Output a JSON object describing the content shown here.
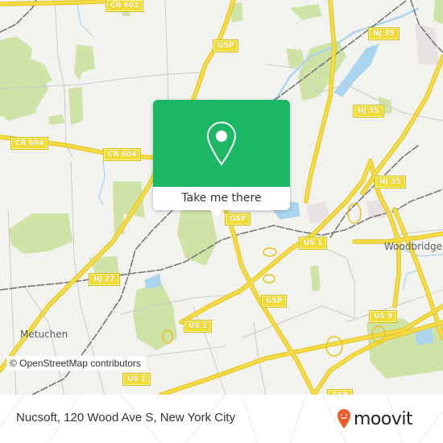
{
  "map": {
    "colors": {
      "background": "#f2f2ee",
      "park": "#cfe3a6",
      "water": "#a9d6ee",
      "highway": "#f5dc47",
      "highway_casing": "#e3c51c",
      "minor_road": "#c9c9c9",
      "railway": "#777777"
    },
    "road_shields": [
      {
        "id": "cr602",
        "label": "CR 602"
      },
      {
        "id": "gsp-north",
        "label": "GSP"
      },
      {
        "id": "nj35-north",
        "label": "NJ 35"
      },
      {
        "id": "nj35-mid",
        "label": "NJ 35"
      },
      {
        "id": "cr604-west",
        "label": "CR 604"
      },
      {
        "id": "cr604-east",
        "label": "CR 604"
      },
      {
        "id": "nj35-south",
        "label": "NJ 35"
      },
      {
        "id": "gsp-center",
        "label": "GSP"
      },
      {
        "id": "us1-east",
        "label": "US 1"
      },
      {
        "id": "nj27",
        "label": "NJ 27"
      },
      {
        "id": "gsp-south",
        "label": "GSP"
      },
      {
        "id": "us1-west",
        "label": "US 1"
      },
      {
        "id": "us9",
        "label": "US 9"
      },
      {
        "id": "us1-bottom",
        "label": "US 1"
      },
      {
        "id": "gsp-bottom",
        "label": "GSP"
      }
    ],
    "places": [
      {
        "id": "metuchen",
        "label": "Metuchen"
      },
      {
        "id": "woodbridge",
        "label": "Woodbridge"
      }
    ],
    "attribution": "© OpenStreetMap contributors"
  },
  "popup": {
    "icon": "location-pin-icon",
    "action_label": "Take me there",
    "accent": "#1db866"
  },
  "footer": {
    "address": "Nucsoft, 120 Wood Ave S, New York City",
    "brand": "moovit",
    "brand_icon": "moovit-smiley-pin-icon",
    "brand_color": "#f05a28"
  }
}
